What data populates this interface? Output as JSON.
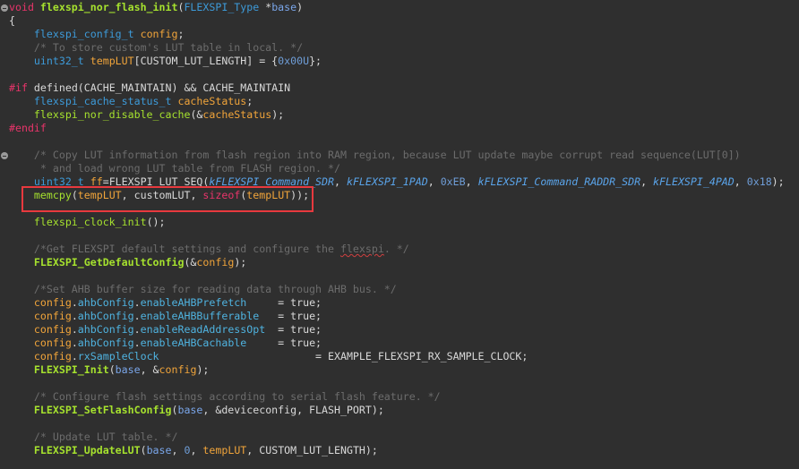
{
  "editor": {
    "lines": [
      [
        [
          "kw",
          "void "
        ],
        [
          "fn",
          "flexspi_nor_flash_init"
        ],
        [
          "tx",
          "("
        ],
        [
          "type",
          "FLEXSPI_Type"
        ],
        [
          "tx",
          " *"
        ],
        [
          "param",
          "base"
        ],
        [
          "tx",
          ")"
        ]
      ],
      [
        [
          "tx",
          "{"
        ]
      ],
      [
        [
          "tx",
          "    "
        ],
        [
          "type",
          "flexspi_config_t"
        ],
        [
          "tx",
          " "
        ],
        [
          "var",
          "config"
        ],
        [
          "tx",
          ";"
        ]
      ],
      [
        [
          "tx",
          "    "
        ],
        [
          "cm",
          "/* To store custom's LUT table in local. */"
        ]
      ],
      [
        [
          "tx",
          "    "
        ],
        [
          "type",
          "uint32_t"
        ],
        [
          "tx",
          " "
        ],
        [
          "var",
          "tempLUT"
        ],
        [
          "tx",
          "[CUSTOM_LUT_LENGTH] = {"
        ],
        [
          "num",
          "0x00U"
        ],
        [
          "tx",
          "};"
        ]
      ],
      [],
      [
        [
          "pp",
          "#if"
        ],
        [
          "tx",
          " defined(CACHE_MAINTAIN) && CACHE_MAINTAIN"
        ]
      ],
      [
        [
          "tx",
          "    "
        ],
        [
          "type",
          "flexspi_cache_status_t"
        ],
        [
          "tx",
          " "
        ],
        [
          "var",
          "cacheStatus"
        ],
        [
          "tx",
          ";"
        ]
      ],
      [
        [
          "tx",
          "    "
        ],
        [
          "fnn",
          "flexspi_nor_disable_cache"
        ],
        [
          "tx",
          "(&"
        ],
        [
          "var",
          "cacheStatus"
        ],
        [
          "tx",
          ");"
        ]
      ],
      [
        [
          "pp",
          "#endif"
        ]
      ],
      [],
      [
        [
          "tx",
          "    "
        ],
        [
          "cm",
          "/* Copy LUT information from flash region into RAM region, because LUT update maybe corrupt read sequence(LUT[0])"
        ]
      ],
      [
        [
          "tx",
          "    "
        ],
        [
          "cm",
          " * and load wrong LUT table from FLASH region. */"
        ]
      ],
      [
        [
          "tx",
          "    "
        ],
        [
          "type",
          "uint32_t"
        ],
        [
          "tx",
          " "
        ],
        [
          "var",
          "ff"
        ],
        [
          "tx",
          "=FLEXSPI_LUT_SEQ("
        ],
        [
          "enum",
          "kFLEXSPI_Command_SDR"
        ],
        [
          "tx",
          ", "
        ],
        [
          "enum",
          "kFLEXSPI_1PAD"
        ],
        [
          "tx",
          ", "
        ],
        [
          "num",
          "0xEB"
        ],
        [
          "tx",
          ", "
        ],
        [
          "enum",
          "kFLEXSPI_Command_RADDR_SDR"
        ],
        [
          "tx",
          ", "
        ],
        [
          "enum",
          "kFLEXSPI_4PAD"
        ],
        [
          "tx",
          ", "
        ],
        [
          "num",
          "0x18"
        ],
        [
          "tx",
          ");"
        ]
      ],
      [
        [
          "tx",
          "    "
        ],
        [
          "fnn",
          "memcpy"
        ],
        [
          "tx",
          "("
        ],
        [
          "var",
          "tempLUT"
        ],
        [
          "tx",
          ", customLUT, "
        ],
        [
          "kw",
          "sizeof"
        ],
        [
          "tx",
          "("
        ],
        [
          "var",
          "tempLUT"
        ],
        [
          "tx",
          "));"
        ]
      ],
      [],
      [
        [
          "tx",
          "    "
        ],
        [
          "fnn",
          "flexspi_clock_init"
        ],
        [
          "tx",
          "();"
        ]
      ],
      [],
      [
        [
          "tx",
          "    "
        ],
        [
          "cm",
          "/*Get FLEXSPI default settings and configure the "
        ],
        [
          "cm squig",
          "flexspi"
        ],
        [
          "cm",
          ". */"
        ]
      ],
      [
        [
          "tx",
          "    "
        ],
        [
          "fn",
          "FLEXSPI_GetDefaultConfig"
        ],
        [
          "tx",
          "(&"
        ],
        [
          "var",
          "config"
        ],
        [
          "tx",
          ");"
        ]
      ],
      [],
      [
        [
          "tx",
          "    "
        ],
        [
          "cm",
          "/*Set AHB buffer size for reading data through AHB bus. */"
        ]
      ],
      [
        [
          "tx",
          "    "
        ],
        [
          "var",
          "config"
        ],
        [
          "tx",
          "."
        ],
        [
          "field",
          "ahbConfig"
        ],
        [
          "tx",
          "."
        ],
        [
          "field",
          "enableAHBPrefetch"
        ],
        [
          "tx",
          "     = true;"
        ]
      ],
      [
        [
          "tx",
          "    "
        ],
        [
          "var",
          "config"
        ],
        [
          "tx",
          "."
        ],
        [
          "field",
          "ahbConfig"
        ],
        [
          "tx",
          "."
        ],
        [
          "field",
          "enableAHBBufferable"
        ],
        [
          "tx",
          "   = true;"
        ]
      ],
      [
        [
          "tx",
          "    "
        ],
        [
          "var",
          "config"
        ],
        [
          "tx",
          "."
        ],
        [
          "field",
          "ahbConfig"
        ],
        [
          "tx",
          "."
        ],
        [
          "field",
          "enableReadAddressOpt"
        ],
        [
          "tx",
          "  = true;"
        ]
      ],
      [
        [
          "tx",
          "    "
        ],
        [
          "var",
          "config"
        ],
        [
          "tx",
          "."
        ],
        [
          "field",
          "ahbConfig"
        ],
        [
          "tx",
          "."
        ],
        [
          "field",
          "enableAHBCachable"
        ],
        [
          "tx",
          "     = true;"
        ]
      ],
      [
        [
          "tx",
          "    "
        ],
        [
          "var",
          "config"
        ],
        [
          "tx",
          "."
        ],
        [
          "field",
          "rxSampleClock"
        ],
        [
          "tx",
          "                         = EXAMPLE_FLEXSPI_RX_SAMPLE_CLOCK;"
        ]
      ],
      [
        [
          "tx",
          "    "
        ],
        [
          "fn",
          "FLEXSPI_Init"
        ],
        [
          "tx",
          "("
        ],
        [
          "param",
          "base"
        ],
        [
          "tx",
          ", &"
        ],
        [
          "var",
          "config"
        ],
        [
          "tx",
          ");"
        ]
      ],
      [],
      [
        [
          "tx",
          "    "
        ],
        [
          "cm",
          "/* Configure flash settings according to serial flash feature. */"
        ]
      ],
      [
        [
          "tx",
          "    "
        ],
        [
          "fn",
          "FLEXSPI_SetFlashConfig"
        ],
        [
          "tx",
          "("
        ],
        [
          "param",
          "base"
        ],
        [
          "tx",
          ", &deviceconfig, FLASH_PORT);"
        ]
      ],
      [],
      [
        [
          "tx",
          "    "
        ],
        [
          "cm",
          "/* Update LUT table. */"
        ]
      ],
      [
        [
          "tx",
          "    "
        ],
        [
          "fn",
          "FLEXSPI_UpdateLUT"
        ],
        [
          "tx",
          "("
        ],
        [
          "param",
          "base"
        ],
        [
          "tx",
          ", "
        ],
        [
          "num",
          "0"
        ],
        [
          "tx",
          ", "
        ],
        [
          "var",
          "tempLUT"
        ],
        [
          "tx",
          ", CUSTOM_LUT_LENGTH);"
        ]
      ]
    ]
  },
  "colors": {
    "background": "#2f2f2f",
    "keyword": "#e8346a",
    "function": "#a6e22e",
    "type": "#3d9ad8",
    "variable": "#f0a43a",
    "comment": "#6c6c6c",
    "highlight_box": "#e8393e"
  }
}
